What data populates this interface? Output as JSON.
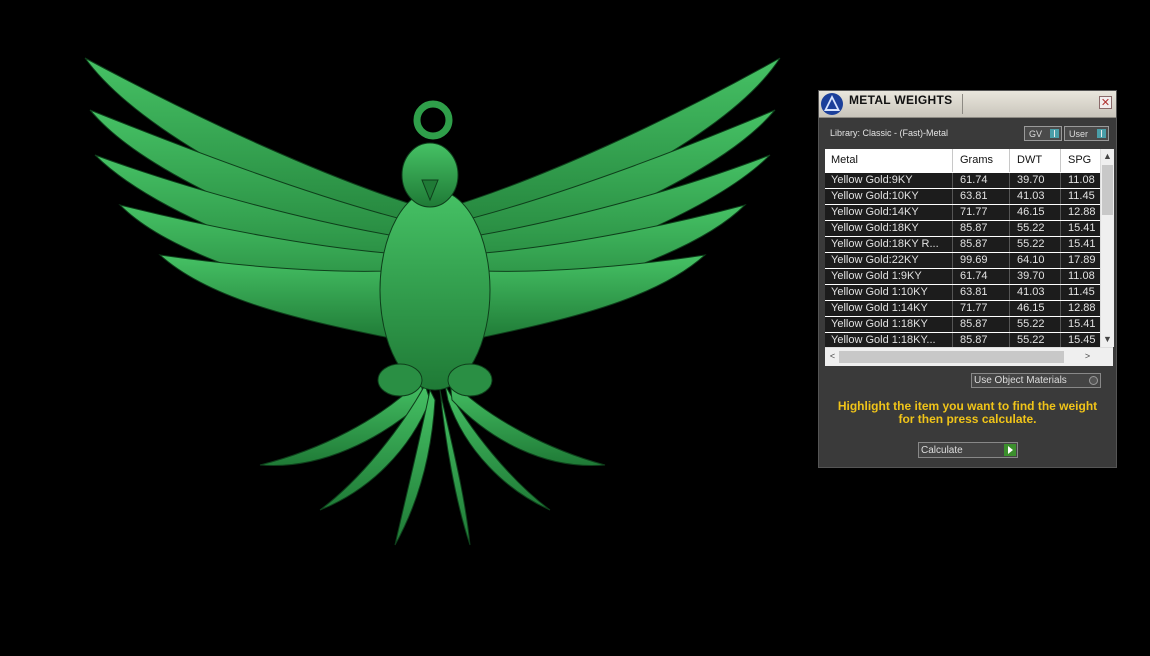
{
  "panel": {
    "title": "METAL WEIGHTS",
    "close_glyph": "✕",
    "library_label": "Library: Classic - (Fast)-Metal",
    "toggle_gv": "GV",
    "toggle_user": "User",
    "use_object_materials": "Use Object Materials",
    "hint_line1": "Highlight the item you want to find the weight",
    "hint_line2": "for then press calculate.",
    "calculate_label": "Calculate"
  },
  "table": {
    "headers": [
      "Metal",
      "Grams",
      "DWT",
      "SPG"
    ],
    "rows": [
      [
        "Yellow Gold:9KY",
        "61.74",
        "39.70",
        "11.08"
      ],
      [
        "Yellow Gold:10KY",
        "63.81",
        "41.03",
        "11.45"
      ],
      [
        "Yellow Gold:14KY",
        "71.77",
        "46.15",
        "12.88"
      ],
      [
        "Yellow Gold:18KY",
        "85.87",
        "55.22",
        "15.41"
      ],
      [
        "Yellow Gold:18KY R...",
        "85.87",
        "55.22",
        "15.41"
      ],
      [
        "Yellow Gold:22KY",
        "99.69",
        "64.10",
        "17.89"
      ],
      [
        "Yellow Gold 1:9KY",
        "61.74",
        "39.70",
        "11.08"
      ],
      [
        "Yellow Gold 1:10KY",
        "63.81",
        "41.03",
        "11.45"
      ],
      [
        "Yellow Gold 1:14KY",
        "71.77",
        "46.15",
        "12.88"
      ],
      [
        "Yellow Gold 1:18KY",
        "85.87",
        "55.22",
        "15.41"
      ],
      [
        "Yellow Gold 1:18KY...",
        "85.87",
        "55.22",
        "15.45"
      ]
    ]
  },
  "scroll": {
    "up": "▲",
    "down": "▼",
    "left": "<",
    "right": ">"
  },
  "colors": {
    "model": "#2f9f4a",
    "hint": "#f0c419",
    "toggle_indicator": "#4a9ea8",
    "calculate_play": "#3c8f2d"
  },
  "icons": [
    "app-logo-icon",
    "close-icon",
    "play-icon",
    "scroll-up-icon",
    "scroll-down-icon"
  ]
}
